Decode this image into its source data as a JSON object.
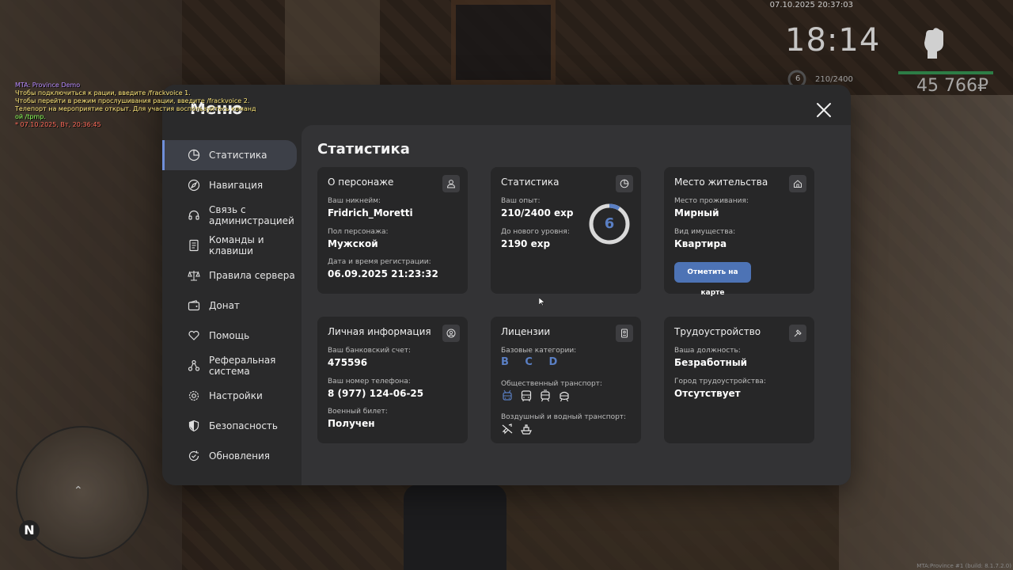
{
  "hud": {
    "datetime": "07.10.2025 20:37:03",
    "clock": "18:14",
    "level": "6",
    "exp": "210/2400",
    "money": "45 766₽",
    "build": "MTA:Province #1 (build: 8.1.7.2.0)"
  },
  "chat": [
    {
      "text": "MTA: Province Demo",
      "color": "violet"
    },
    {
      "text": "Чтобы подключиться к рации, введите /frackvoice 1.",
      "color": "yellow"
    },
    {
      "text": "Чтобы перейти в режим прослушивания рации, введите /frackvoice 2.",
      "color": "yellow"
    },
    {
      "text": "Телепорт на мероприятие открыт. Для участия воспользуйтесь команд",
      "color": "yellow"
    },
    {
      "text": "ой /tpmp.",
      "color": "green"
    },
    {
      "text": "* 07.10.2025, Вт, 20:36:45",
      "color": "red"
    }
  ],
  "minimap": {
    "north": "N"
  },
  "menu": {
    "title": "Меню",
    "sidebar": [
      {
        "label": "Статистика",
        "icon": "pie-chart-icon",
        "active": true
      },
      {
        "label": "Навигация",
        "icon": "compass-icon"
      },
      {
        "label": "Связь с администрацией",
        "icon": "headset-icon"
      },
      {
        "label": "Команды и клавиши",
        "icon": "document-icon"
      },
      {
        "label": "Правила сервера",
        "icon": "scales-icon"
      },
      {
        "label": "Донат",
        "icon": "wallet-icon"
      },
      {
        "label": "Помощь",
        "icon": "heart-hand-icon"
      },
      {
        "label": "Реферальная система",
        "icon": "network-icon"
      },
      {
        "label": "Настройки",
        "icon": "gear-icon"
      },
      {
        "label": "Безопасность",
        "icon": "shield-icon"
      },
      {
        "label": "Обновления",
        "icon": "refresh-check-icon"
      }
    ],
    "content_title": "Статистика",
    "cards": {
      "character": {
        "title": "О персонаже",
        "nick_label": "Ваш никнейм:",
        "nick": "Fridrich_Moretti",
        "gender_label": "Пол персонажа:",
        "gender": "Мужской",
        "reg_label": "Дата и время регистрации:",
        "reg": "06.09.2025 21:23:32"
      },
      "stats": {
        "title": "Статистика",
        "exp_label": "Ваш опыт:",
        "exp": "210/2400 exp",
        "next_label": "До нового уровня:",
        "next": "2190 exp",
        "level": "6",
        "level_progress": 0.0875
      },
      "residence": {
        "title": "Место жительства",
        "place_label": "Место проживания:",
        "place": "Мирный",
        "type_label": "Вид имущества:",
        "type": "Квартира",
        "button": "Отметить на карте"
      },
      "personal": {
        "title": "Личная информация",
        "bank_label": "Ваш банковский счет:",
        "bank": "475596",
        "phone_label": "Ваш номер телефона:",
        "phone": "8 (977) 124-06-25",
        "military_label": "Военный билет:",
        "military": "Получен"
      },
      "licenses": {
        "title": "Лицензии",
        "base_label": "Базовые категории:",
        "base": "B C D",
        "public_label": "Общественный транспорт:",
        "air_label": "Воздушный и водный транспорт:"
      },
      "job": {
        "title": "Трудоустройство",
        "pos_label": "Ваша должность:",
        "pos": "Безработный",
        "city_label": "Город трудоустройства:",
        "city": "Отсутствует"
      }
    }
  },
  "colors": {
    "accent": "#4d73b5",
    "panel": "#2a2a2b",
    "card": "#272728"
  }
}
